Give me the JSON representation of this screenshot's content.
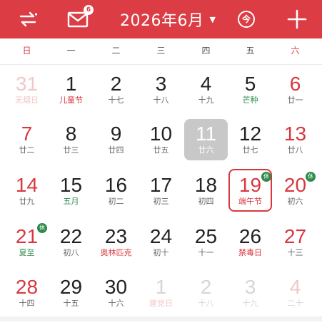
{
  "header": {
    "title": "2026年6月",
    "mail_badge": "6",
    "today_glyph": "今",
    "icons": {
      "menu": "swap-arrows-icon",
      "mail": "envelope-icon",
      "dropdown": "caret-down-icon",
      "add": "plus-icon"
    },
    "bg_color": "#dc3c44"
  },
  "weekdays": [
    "日",
    "一",
    "二",
    "三",
    "四",
    "五",
    "六"
  ],
  "holiday_badge": "休",
  "weeks": [
    [
      {
        "d": "31",
        "s": "无烟日"
      },
      {
        "d": "1",
        "s": "儿童节"
      },
      {
        "d": "2",
        "s": "十七"
      },
      {
        "d": "3",
        "s": "十八"
      },
      {
        "d": "4",
        "s": "十九"
      },
      {
        "d": "5",
        "s": "芒种"
      },
      {
        "d": "6",
        "s": "廿一"
      }
    ],
    [
      {
        "d": "7",
        "s": "廿二"
      },
      {
        "d": "8",
        "s": "廿三"
      },
      {
        "d": "9",
        "s": "廿四"
      },
      {
        "d": "10",
        "s": "廿五"
      },
      {
        "d": "11",
        "s": "廿六"
      },
      {
        "d": "12",
        "s": "廿七"
      },
      {
        "d": "13",
        "s": "廿八"
      }
    ],
    [
      {
        "d": "14",
        "s": "廿九"
      },
      {
        "d": "15",
        "s": "五月"
      },
      {
        "d": "16",
        "s": "初二"
      },
      {
        "d": "17",
        "s": "初三"
      },
      {
        "d": "18",
        "s": "初四"
      },
      {
        "d": "19",
        "s": "端午节"
      },
      {
        "d": "20",
        "s": "初六"
      }
    ],
    [
      {
        "d": "21",
        "s": "夏至"
      },
      {
        "d": "22",
        "s": "初八"
      },
      {
        "d": "23",
        "s": "奥林匹克"
      },
      {
        "d": "24",
        "s": "初十"
      },
      {
        "d": "25",
        "s": "十一"
      },
      {
        "d": "26",
        "s": "禁毒日"
      },
      {
        "d": "27",
        "s": "十三"
      }
    ],
    [
      {
        "d": "28",
        "s": "十四"
      },
      {
        "d": "29",
        "s": "十五"
      },
      {
        "d": "30",
        "s": "十六"
      },
      {
        "d": "1",
        "s": "建党日"
      },
      {
        "d": "2",
        "s": "十八"
      },
      {
        "d": "3",
        "s": "十九"
      },
      {
        "d": "4",
        "s": "二十"
      }
    ]
  ]
}
